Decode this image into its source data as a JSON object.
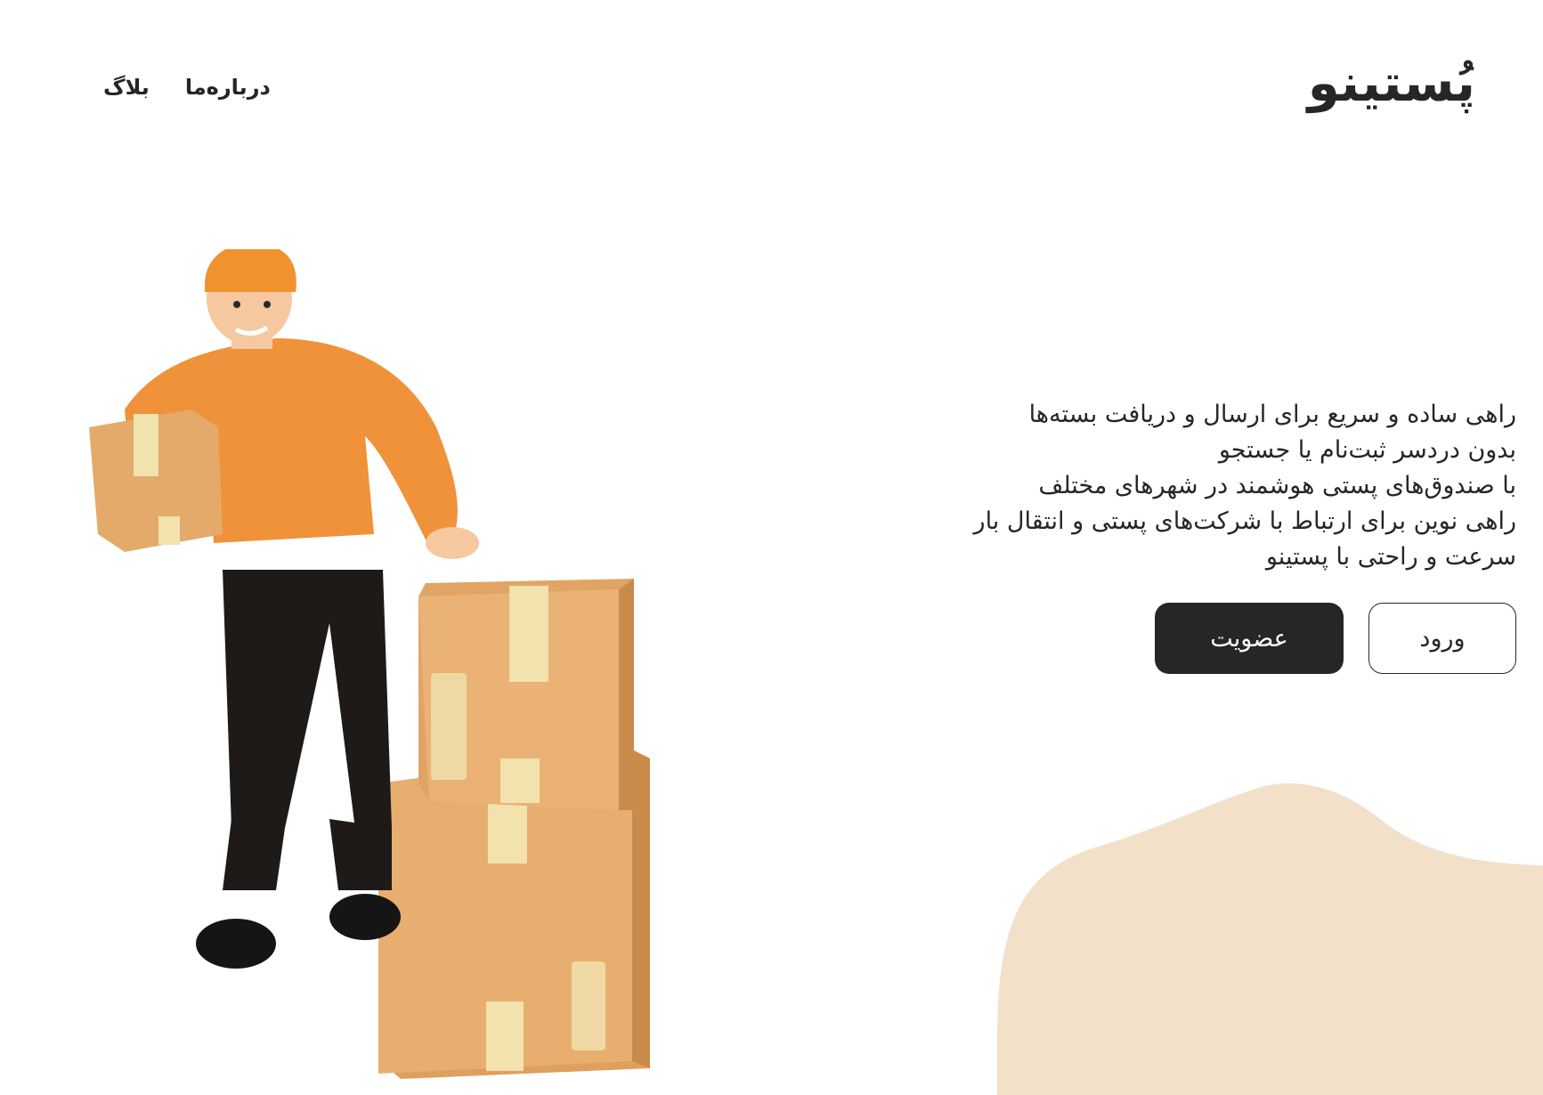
{
  "header": {
    "logo": "پُستینو",
    "nav": [
      {
        "label": "بلاگ"
      },
      {
        "label": "درباره‌ما"
      }
    ]
  },
  "hero": {
    "lines": [
      "راهی ساده و سریع برای ارسال و دریافت بسته‌ها",
      "بدون دردسر ثبت‌نام یا جستجو",
      "با صندوق‌های پستی هوشمند در شهرهای مختلف",
      "راهی نوین برای ارتباط با شرکت‌های پستی و انتقال بار",
      "سرعت و راحتی با پستینو"
    ],
    "join_label": "عضویت",
    "login_label": "ورود"
  },
  "colors": {
    "primary": "#262626",
    "blob": "#f3e0c8",
    "shirt": "#f0923a",
    "box": "#e3aa6a"
  }
}
